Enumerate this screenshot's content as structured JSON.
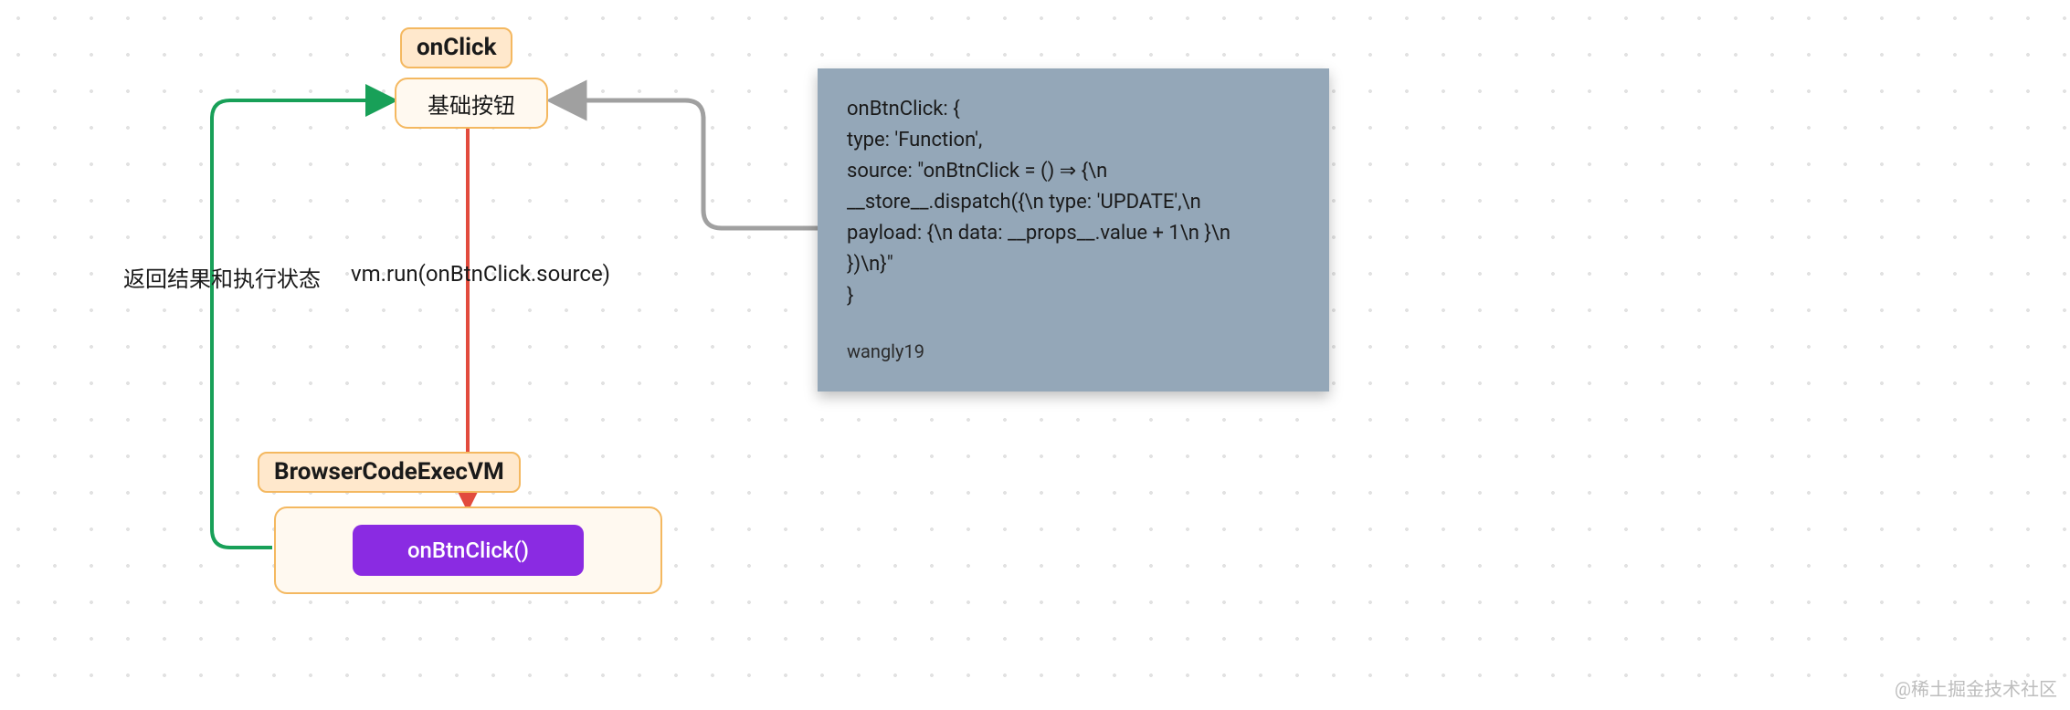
{
  "nodes": {
    "onclick_badge": "onClick",
    "base_button": "基础按钮",
    "vm_badge": "BrowserCodeExecVM",
    "inner_button": "onBtnClick()"
  },
  "edges": {
    "return_label": "返回结果和执行状态",
    "vm_run_label": "vm.run(onBtnClick.source)"
  },
  "code_card": {
    "line1": "onBtnClick: {",
    "line2": "  type: 'Function',",
    "line3": "  source: \"onBtnClick = () ⇒ {\\n",
    "line4": "__store__.dispatch({\\n    type: 'UPDATE',\\n",
    "line5": "payload: {\\n      data: __props__.value + 1\\n    }\\n",
    "line6": "})\\n}\"",
    "line7": "}",
    "author": "wangly19"
  },
  "watermark": "@稀土掘金技术社区",
  "colors": {
    "green": "#18a058",
    "red": "#e24b3d",
    "gray": "#a0a0a0",
    "badge_bg": "#ffe8cc",
    "badge_border": "#f4b860",
    "node_bg": "#fff9f0",
    "purple": "#8a2be2",
    "card_bg": "#94a7b8"
  }
}
